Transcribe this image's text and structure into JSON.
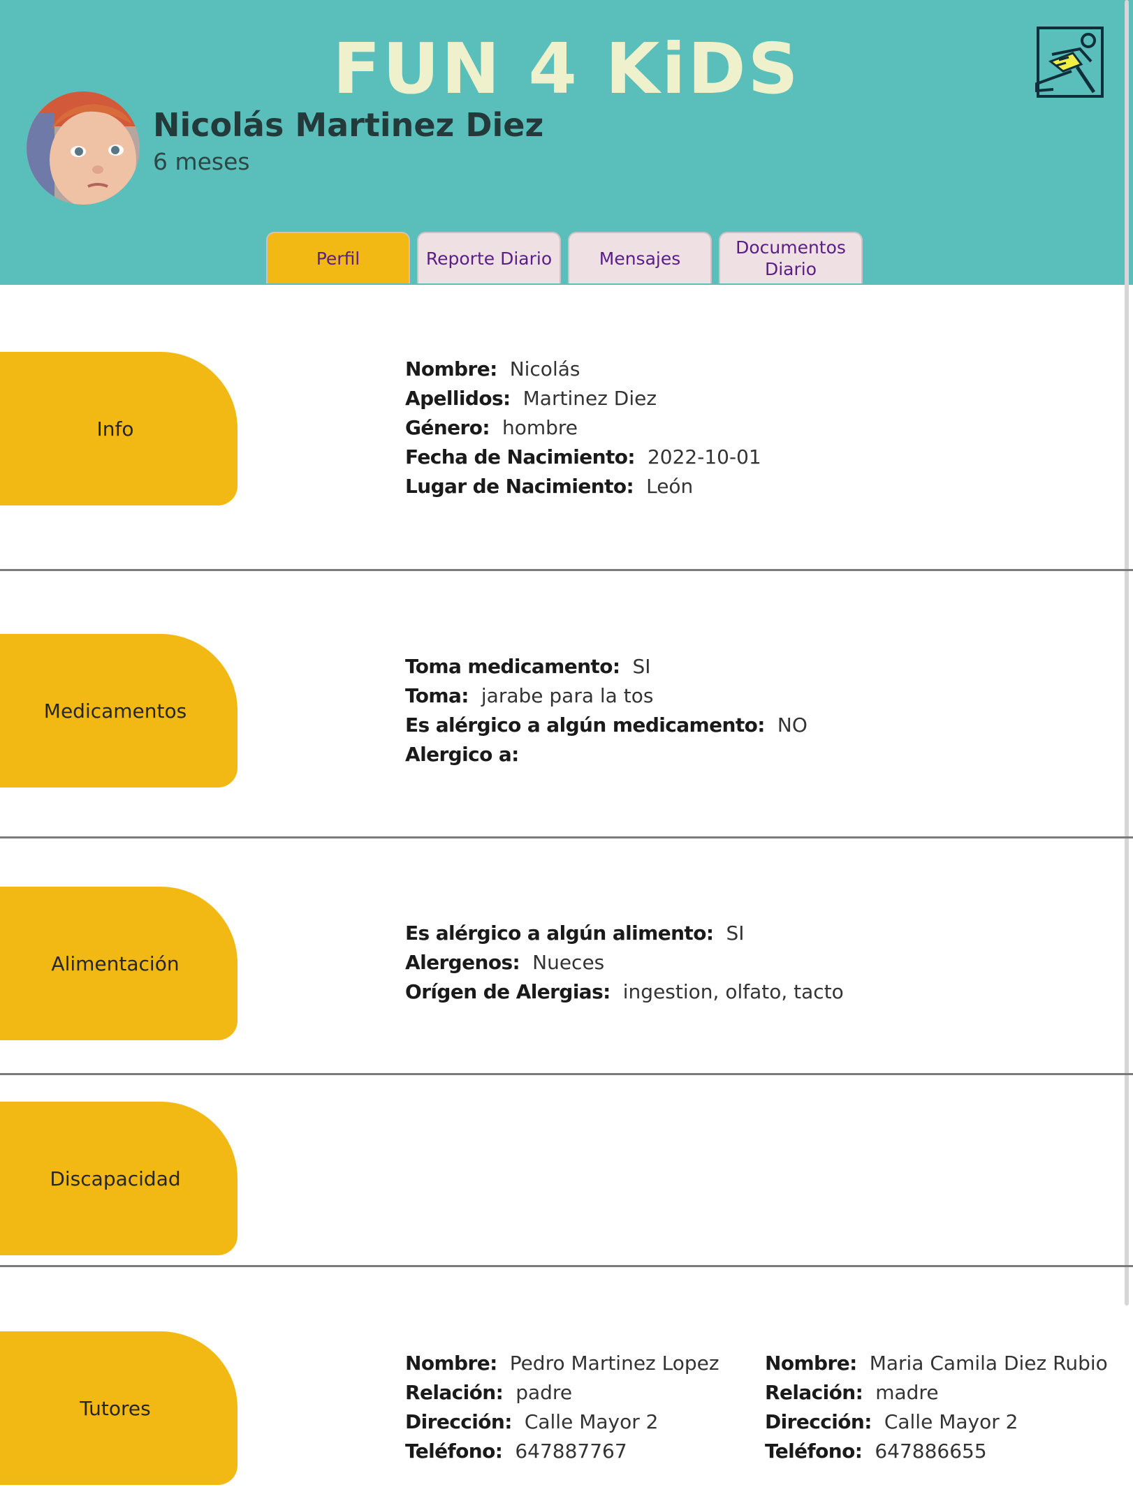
{
  "header": {
    "app_title": "FUN 4 KiDS",
    "logo_icon": "running-person-icon",
    "child_name": "Nicolás Martinez Diez",
    "child_age": "6 meses"
  },
  "tabs": [
    {
      "label": "Perfil",
      "active": true
    },
    {
      "label": "Reporte Diario",
      "active": false
    },
    {
      "label": "Mensajes",
      "active": false
    },
    {
      "label": "Documentos\nDiario",
      "active": false
    }
  ],
  "sections": {
    "info": {
      "label": "Info",
      "fields": [
        {
          "label": "Nombre:",
          "value": "Nicolás"
        },
        {
          "label": "Apellidos:",
          "value": "Martinez Diez"
        },
        {
          "label": "Género:",
          "value": "hombre"
        },
        {
          "label": "Fecha de Nacimiento:",
          "value": "2022-10-01"
        },
        {
          "label": "Lugar de Nacimiento:",
          "value": "León"
        }
      ]
    },
    "medicamentos": {
      "label": "Medicamentos",
      "fields": [
        {
          "label": "Toma medicamento:",
          "value": "SI"
        },
        {
          "label": "Toma:",
          "value": "jarabe para la tos"
        },
        {
          "label": "Es alérgico a algún medicamento:",
          "value": "NO"
        },
        {
          "label": "Alergico a:",
          "value": ""
        }
      ]
    },
    "alimentacion": {
      "label": "Alimentación",
      "fields": [
        {
          "label": "Es alérgico a algún alimento:",
          "value": "SI"
        },
        {
          "label": "Alergenos:",
          "value": "Nueces"
        },
        {
          "label": "Orígen de Alergias:",
          "value": "ingestion, olfato, tacto"
        }
      ]
    },
    "discapacidad": {
      "label": "Discapacidad"
    },
    "tutores": {
      "label": "Tutores",
      "tutor1": [
        {
          "label": "Nombre:",
          "value": "Pedro Martinez Lopez"
        },
        {
          "label": "Relación:",
          "value": "padre"
        },
        {
          "label": "Dirección:",
          "value": "Calle Mayor 2"
        },
        {
          "label": "Teléfono:",
          "value": "647887767"
        }
      ],
      "tutor2": [
        {
          "label": "Nombre:",
          "value": "Maria Camila Diez Rubio"
        },
        {
          "label": "Relación:",
          "value": "madre"
        },
        {
          "label": "Dirección:",
          "value": "Calle Mayor 2"
        },
        {
          "label": "Teléfono:",
          "value": "647886655"
        }
      ]
    }
  },
  "colors": {
    "header_bg": "#5abfbb",
    "accent_yellow": "#f2b813",
    "tab_inactive_bg": "#eee0e3",
    "tab_text": "#5a1e87",
    "title_color": "#eef1cc"
  }
}
